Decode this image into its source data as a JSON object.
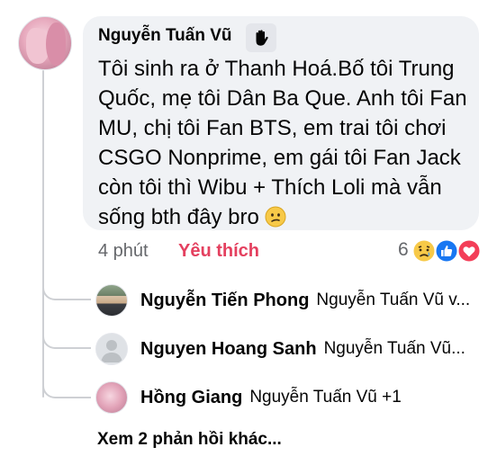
{
  "comment": {
    "author": "Nguyễn Tuấn Vũ",
    "badge_icon": "waving-hand-icon",
    "text_lines": [
      "Tôi sinh ra ở Thanh Hoá.Bố tôi Trung",
      "Quốc, mẹ tôi Dân Ba Que. Anh tôi Fan",
      "MU, chị tôi Fan BTS, em trai tôi chơi",
      "CSGO Nonprime, em gái tôi Fan Jack",
      "còn tôi thì Wibu + Thích Loli mà vẫn",
      "sống bth đây bro"
    ],
    "trailing_emoji": "confused-face-emoji",
    "time": "4 phút",
    "like_action": "Yêu thích",
    "reaction_count": "6",
    "reaction_icons": [
      "sad-reaction-icon",
      "like-reaction-icon",
      "love-reaction-icon"
    ]
  },
  "replies": [
    {
      "name": "Nguyễn Tiến Phong",
      "preview": "Nguyễn Tuấn Vũ v...",
      "avatar": "photo"
    },
    {
      "name": "Nguyen Hoang Sanh",
      "preview": "Nguyễn Tuấn Vũ...",
      "avatar": "default"
    },
    {
      "name": "Hồng Giang",
      "preview": "Nguyễn Tuấn Vũ +1",
      "avatar": "anime"
    }
  ],
  "more_replies": "Xem 2 phản hồi khác...",
  "colors": {
    "bubble": "#f0f2f5",
    "like_action": "#e4405f",
    "meta": "#65676b",
    "thread_line": "#ced0d4"
  }
}
